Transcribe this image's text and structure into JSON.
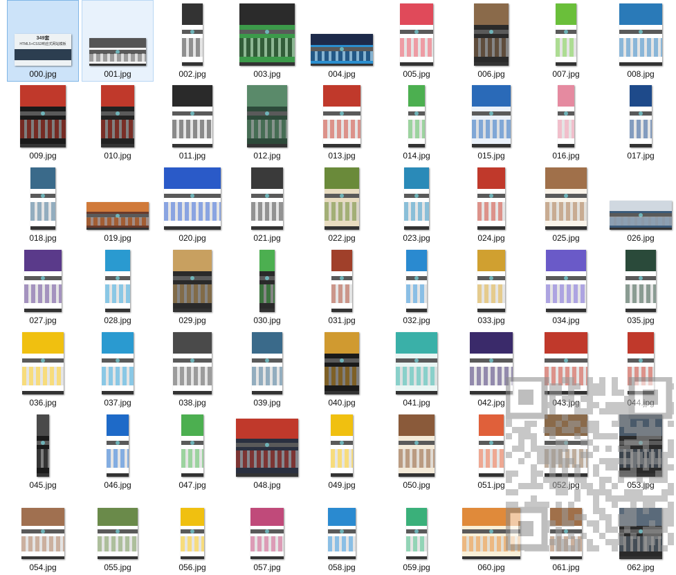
{
  "window": {
    "view": "large-icons"
  },
  "files": [
    {
      "name": "000.jpg",
      "w": 82,
      "h": 46,
      "kind": "cover",
      "bg": "#eef2f4",
      "accent": "#2c3e50",
      "cover_lines": [
        "349套",
        "HTML5+CSS3响应式网站模板"
      ]
    },
    {
      "name": "001.jpg",
      "w": 82,
      "h": 40,
      "kind": "plain",
      "bg": "#f3f3f3",
      "accent": "#555555"
    },
    {
      "name": "002.jpg",
      "w": 30,
      "h": 90,
      "kind": "page",
      "bg": "#ffffff",
      "accent": "#333333"
    },
    {
      "name": "003.jpg",
      "w": 80,
      "h": 90,
      "kind": "page",
      "bg": "#3c9a4a",
      "accent": "#2b2b2b"
    },
    {
      "name": "004.jpg",
      "w": 90,
      "h": 46,
      "kind": "wide",
      "bg": "#2a8fd0",
      "accent": "#1d2a4a"
    },
    {
      "name": "005.jpg",
      "w": 48,
      "h": 90,
      "kind": "page",
      "bg": "#ffffff",
      "accent": "#e04a5a"
    },
    {
      "name": "006.jpg",
      "w": 50,
      "h": 90,
      "kind": "page",
      "bg": "#2a2a2a",
      "accent": "#8a6a4a"
    },
    {
      "name": "007.jpg",
      "w": 30,
      "h": 90,
      "kind": "page",
      "bg": "#ffffff",
      "accent": "#6abf3a"
    },
    {
      "name": "008.jpg",
      "w": 62,
      "h": 90,
      "kind": "page",
      "bg": "#ffffff",
      "accent": "#2a7ab8"
    },
    {
      "name": "009.jpg",
      "w": 66,
      "h": 90,
      "kind": "page",
      "bg": "#1a1a1a",
      "accent": "#c0392b"
    },
    {
      "name": "010.jpg",
      "w": 48,
      "h": 90,
      "kind": "page",
      "bg": "#222222",
      "accent": "#c0392b"
    },
    {
      "name": "011.jpg",
      "w": 58,
      "h": 90,
      "kind": "page",
      "bg": "#ffffff",
      "accent": "#2a2a2a"
    },
    {
      "name": "012.jpg",
      "w": 58,
      "h": 90,
      "kind": "page",
      "bg": "#2d4a3a",
      "accent": "#5a8a6a"
    },
    {
      "name": "013.jpg",
      "w": 54,
      "h": 90,
      "kind": "page",
      "bg": "#ffffff",
      "accent": "#c0392b"
    },
    {
      "name": "014.jpg",
      "w": 24,
      "h": 90,
      "kind": "page",
      "bg": "#ffffff",
      "accent": "#4caf50"
    },
    {
      "name": "015.jpg",
      "w": 56,
      "h": 90,
      "kind": "page",
      "bg": "#eaf1fa",
      "accent": "#2a6ab8"
    },
    {
      "name": "016.jpg",
      "w": 24,
      "h": 90,
      "kind": "page",
      "bg": "#ffffff",
      "accent": "#e58aa0"
    },
    {
      "name": "017.jpg",
      "w": 32,
      "h": 90,
      "kind": "page",
      "bg": "#ffffff",
      "accent": "#1e4a8a"
    },
    {
      "name": "018.jpg",
      "w": 36,
      "h": 90,
      "kind": "page",
      "bg": "#ffffff",
      "accent": "#3a6a8a"
    },
    {
      "name": "019.jpg",
      "w": 90,
      "h": 40,
      "kind": "wide",
      "bg": "#6a3a2a",
      "accent": "#d07a3a"
    },
    {
      "name": "020.jpg",
      "w": 82,
      "h": 90,
      "kind": "page",
      "bg": "#ffffff",
      "accent": "#2a5ac8"
    },
    {
      "name": "021.jpg",
      "w": 46,
      "h": 90,
      "kind": "page",
      "bg": "#ffffff",
      "accent": "#3a3a3a"
    },
    {
      "name": "022.jpg",
      "w": 50,
      "h": 90,
      "kind": "page",
      "bg": "#e8dcc0",
      "accent": "#6a8a3a"
    },
    {
      "name": "023.jpg",
      "w": 36,
      "h": 90,
      "kind": "page",
      "bg": "#ffffff",
      "accent": "#2a8ab8"
    },
    {
      "name": "024.jpg",
      "w": 40,
      "h": 90,
      "kind": "page",
      "bg": "#ffffff",
      "accent": "#c0392b"
    },
    {
      "name": "025.jpg",
      "w": 60,
      "h": 90,
      "kind": "page",
      "bg": "#faf4ea",
      "accent": "#a0704a"
    },
    {
      "name": "026.jpg",
      "w": 90,
      "h": 42,
      "kind": "wide",
      "bg": "#3a5a7a",
      "accent": "#d0d8e0"
    },
    {
      "name": "027.jpg",
      "w": 54,
      "h": 90,
      "kind": "page",
      "bg": "#ffffff",
      "accent": "#5a3a8a"
    },
    {
      "name": "028.jpg",
      "w": 36,
      "h": 90,
      "kind": "page",
      "bg": "#ffffff",
      "accent": "#2a9ad0"
    },
    {
      "name": "029.jpg",
      "w": 56,
      "h": 90,
      "kind": "page",
      "bg": "#2a2a2a",
      "accent": "#c8a060"
    },
    {
      "name": "030.jpg",
      "w": 22,
      "h": 90,
      "kind": "page",
      "bg": "#2a2a2a",
      "accent": "#4caf50"
    },
    {
      "name": "031.jpg",
      "w": 30,
      "h": 90,
      "kind": "page",
      "bg": "#ffffff",
      "accent": "#a0402a"
    },
    {
      "name": "032.jpg",
      "w": 30,
      "h": 90,
      "kind": "page",
      "bg": "#ffffff",
      "accent": "#2a8ad0"
    },
    {
      "name": "033.jpg",
      "w": 40,
      "h": 90,
      "kind": "page",
      "bg": "#ffffff",
      "accent": "#d0a030"
    },
    {
      "name": "034.jpg",
      "w": 58,
      "h": 90,
      "kind": "page",
      "bg": "#ffffff",
      "accent": "#6a5ac8"
    },
    {
      "name": "035.jpg",
      "w": 44,
      "h": 90,
      "kind": "page",
      "bg": "#ffffff",
      "accent": "#2a4a3a"
    },
    {
      "name": "036.jpg",
      "w": 60,
      "h": 90,
      "kind": "page",
      "bg": "#ffffff",
      "accent": "#f0c010"
    },
    {
      "name": "037.jpg",
      "w": 46,
      "h": 90,
      "kind": "page",
      "bg": "#ffffff",
      "accent": "#2a9ad0"
    },
    {
      "name": "038.jpg",
      "w": 56,
      "h": 90,
      "kind": "page",
      "bg": "#ffffff",
      "accent": "#4a4a4a"
    },
    {
      "name": "039.jpg",
      "w": 44,
      "h": 90,
      "kind": "page",
      "bg": "#ffffff",
      "accent": "#3a6a8a"
    },
    {
      "name": "040.jpg",
      "w": 50,
      "h": 90,
      "kind": "page",
      "bg": "#1a1a1a",
      "accent": "#d09a30"
    },
    {
      "name": "041.jpg",
      "w": 60,
      "h": 90,
      "kind": "page",
      "bg": "#eaf6f4",
      "accent": "#3ab0a8"
    },
    {
      "name": "042.jpg",
      "w": 62,
      "h": 90,
      "kind": "page",
      "bg": "#ffffff",
      "accent": "#3a2a6a"
    },
    {
      "name": "043.jpg",
      "w": 62,
      "h": 90,
      "kind": "page",
      "bg": "#ffffff",
      "accent": "#c0392b"
    },
    {
      "name": "044.jpg",
      "w": 38,
      "h": 90,
      "kind": "page",
      "bg": "#ffffff",
      "accent": "#c0392b"
    },
    {
      "name": "045.jpg",
      "w": 18,
      "h": 90,
      "kind": "page",
      "bg": "#1a1a1a",
      "accent": "#4a4a4a"
    },
    {
      "name": "046.jpg",
      "w": 32,
      "h": 90,
      "kind": "page",
      "bg": "#ffffff",
      "accent": "#1e6ac8"
    },
    {
      "name": "047.jpg",
      "w": 32,
      "h": 90,
      "kind": "page",
      "bg": "#ffffff",
      "accent": "#4caf50"
    },
    {
      "name": "048.jpg",
      "w": 90,
      "h": 84,
      "kind": "page",
      "bg": "#2a3040",
      "accent": "#c0392b"
    },
    {
      "name": "049.jpg",
      "w": 32,
      "h": 90,
      "kind": "page",
      "bg": "#ffffff",
      "accent": "#f0c010"
    },
    {
      "name": "050.jpg",
      "w": 52,
      "h": 90,
      "kind": "page",
      "bg": "#f4ead8",
      "accent": "#8a5a3a"
    },
    {
      "name": "051.jpg",
      "w": 36,
      "h": 90,
      "kind": "page",
      "bg": "#ffffff",
      "accent": "#e0603a"
    },
    {
      "name": "052.jpg",
      "w": 62,
      "h": 90,
      "kind": "page",
      "bg": "#ffffff",
      "accent": "#8a6a4a"
    },
    {
      "name": "053.jpg",
      "w": 62,
      "h": 90,
      "kind": "page",
      "bg": "#2a2a2a",
      "accent": "#4a5a6a"
    },
    {
      "name": "054.jpg",
      "w": 62,
      "h": 74,
      "kind": "page",
      "bg": "#ffffff",
      "accent": "#a07050"
    },
    {
      "name": "055.jpg",
      "w": 58,
      "h": 74,
      "kind": "page",
      "bg": "#ffffff",
      "accent": "#6a8a4a"
    },
    {
      "name": "056.jpg",
      "w": 34,
      "h": 74,
      "kind": "page",
      "bg": "#ffffff",
      "accent": "#f0c010"
    },
    {
      "name": "057.jpg",
      "w": 48,
      "h": 74,
      "kind": "page",
      "bg": "#ffffff",
      "accent": "#c04a7a"
    },
    {
      "name": "058.jpg",
      "w": 40,
      "h": 74,
      "kind": "page",
      "bg": "#ffffff",
      "accent": "#2a8ad0"
    },
    {
      "name": "059.jpg",
      "w": 30,
      "h": 74,
      "kind": "page",
      "bg": "#ffffff",
      "accent": "#3ab07a"
    },
    {
      "name": "060.jpg",
      "w": 84,
      "h": 74,
      "kind": "page",
      "bg": "#faf0d8",
      "accent": "#e08a3a"
    },
    {
      "name": "061.jpg",
      "w": 46,
      "h": 74,
      "kind": "page",
      "bg": "#ffffff",
      "accent": "#a0704a"
    },
    {
      "name": "062.jpg",
      "w": 62,
      "h": 74,
      "kind": "page",
      "bg": "#2a2a2a",
      "accent": "#5a6a7a"
    }
  ],
  "selection": {
    "selected": [
      "000.jpg"
    ],
    "hover": [
      "001.jpg"
    ]
  },
  "overlay": {
    "icon": "qr-code-icon"
  }
}
